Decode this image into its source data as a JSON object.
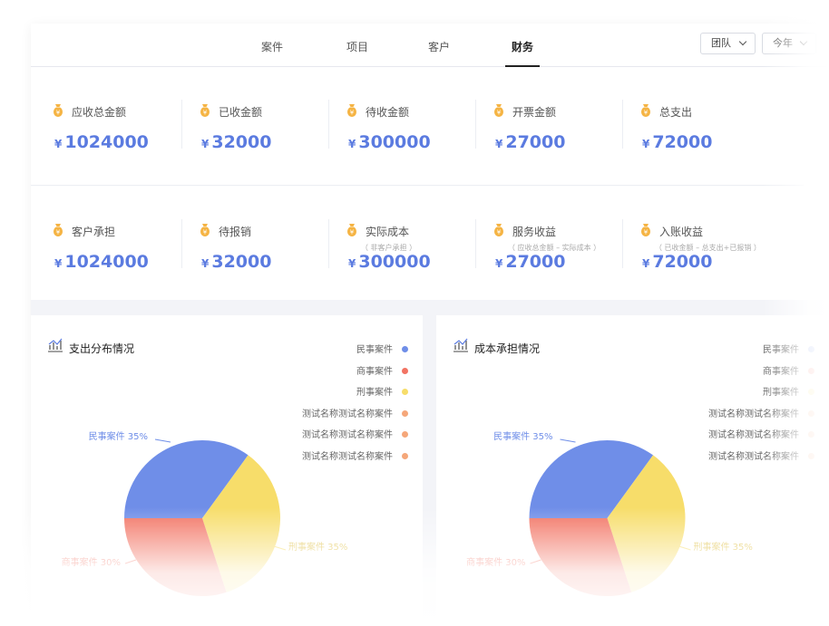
{
  "tabs": [
    {
      "label": "案件"
    },
    {
      "label": "项目"
    },
    {
      "label": "客户"
    },
    {
      "label": "财务",
      "active": true
    }
  ],
  "filters": {
    "team": "团队",
    "period": "今年"
  },
  "currency": "¥",
  "stats_row1": [
    {
      "label": "应收总金额",
      "value": "1024000"
    },
    {
      "label": "已收金额",
      "value": "32000"
    },
    {
      "label": "待收金额",
      "value": "300000"
    },
    {
      "label": "开票金额",
      "value": "27000"
    },
    {
      "label": "总支出",
      "value": "72000"
    }
  ],
  "stats_row2": [
    {
      "label": "客户承担",
      "sub": "",
      "value": "1024000"
    },
    {
      "label": "待报销",
      "sub": "",
      "value": "32000"
    },
    {
      "label": "实际成本",
      "sub": "（ 非客户承担 ）",
      "value": "300000"
    },
    {
      "label": "服务收益",
      "sub": "（ 应收总金额 – 实际成本 ）",
      "value": "27000"
    },
    {
      "label": "入账收益",
      "sub": "（ 已收金额 – 总支出+已报销 ）",
      "value": "72000"
    }
  ],
  "colors": {
    "accent": "#5b7be0",
    "icon_gold": "#f5b444",
    "blue": "#6f8ee8",
    "red": "#f27363",
    "yellow": "#f7dd6a",
    "orange": "#f5a77a"
  },
  "chart_data": [
    {
      "type": "pie",
      "title": "支出分布情况",
      "legend": [
        "民事案件",
        "商事案件",
        "刑事案件",
        "测试名称测试名称案件",
        "测试名称测试名称案件",
        "测试名称测试名称案件"
      ],
      "legend_colors": [
        "#6f8ee8",
        "#f27363",
        "#f7dd6a",
        "#f5a77a",
        "#f5a77a",
        "#f5a77a"
      ],
      "slices": [
        {
          "name": "民事案件",
          "value": 35,
          "label": "民事案件  35%",
          "color": "#6f8ee8"
        },
        {
          "name": "刑事案件",
          "value": 35,
          "label": "刑事案件  35%",
          "color": "#f7dd6a"
        },
        {
          "name": "商事案件",
          "value": 30,
          "label": "商事案件  30%",
          "color": "#f27363"
        }
      ]
    },
    {
      "type": "pie",
      "title": "成本承担情况",
      "legend": [
        "民事案件",
        "商事案件",
        "刑事案件",
        "测试名称测试名称案件",
        "测试名称测试名称案件",
        "测试名称测试名称案件"
      ],
      "legend_colors": [
        "#6f8ee8",
        "#f27363",
        "#f7dd6a",
        "#f5a77a",
        "#f5a77a",
        "#f5a77a"
      ],
      "slices": [
        {
          "name": "民事案件",
          "value": 35,
          "label": "民事案件  35%",
          "color": "#6f8ee8"
        },
        {
          "name": "刑事案件",
          "value": 35,
          "label": "刑事案件  35%",
          "color": "#f7dd6a"
        },
        {
          "name": "商事案件",
          "value": 30,
          "label": "商事案件  30%",
          "color": "#f27363"
        }
      ]
    }
  ]
}
